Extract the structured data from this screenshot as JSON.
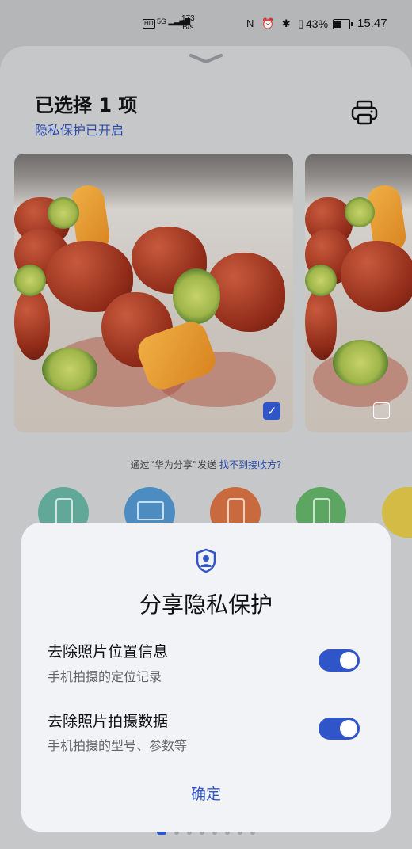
{
  "status_bar": {
    "hd": "HD",
    "signal": "5G",
    "speed_value": "173",
    "speed_unit": "B/s",
    "icons": "N ⏰ ✱ ▯",
    "battery": "43%",
    "time": "15:47"
  },
  "header": {
    "title": "已选择 1 项",
    "privacy_status": "隐私保护已开启"
  },
  "photos": [
    {
      "selected": true
    },
    {
      "selected": false
    }
  ],
  "share": {
    "prefix": "通过“华为分享”发送",
    "link": "找不到接收方?"
  },
  "contacts": [
    {
      "icon": "phone-icon",
      "color": "#62a898"
    },
    {
      "icon": "laptop-icon",
      "color": "#4d8cc0"
    },
    {
      "icon": "phone-icon",
      "color": "#c86a3e"
    },
    {
      "icon": "phone-icon",
      "color": "#5da662"
    },
    {
      "icon": "device-icon",
      "color": "#d3bb45"
    }
  ],
  "dialog": {
    "title": "分享隐私保护",
    "options": [
      {
        "title": "去除照片位置信息",
        "desc": "手机拍摄的定位记录",
        "on": true
      },
      {
        "title": "去除照片拍摄数据",
        "desc": "手机拍摄的型号、参数等",
        "on": true
      }
    ],
    "confirm": "确定"
  },
  "colors": {
    "accent": "#2f55c8",
    "link": "#2a4aa8"
  }
}
